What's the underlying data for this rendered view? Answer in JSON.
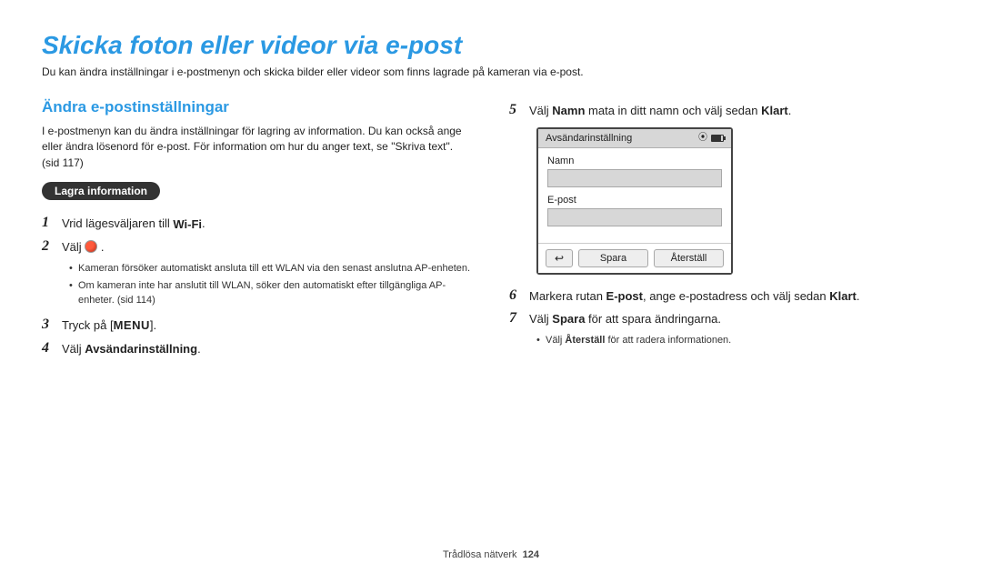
{
  "title": "Skicka foton eller videor via e-post",
  "intro": "Du kan ändra inställningar i e-postmenyn och skicka bilder eller videor som finns lagrade på kameran via e-post.",
  "left": {
    "heading": "Ändra e-postinställningar",
    "para": "I e-postmenyn kan du ändra inställningar för lagring av information. Du kan också ange eller ändra lösenord för e-post. För information om hur du anger text, se \"Skriva text\". (sid 117)",
    "pill": "Lagra information",
    "steps": {
      "s1_pre": "Vrid lägesväljaren till ",
      "wifi_label": "Wi-Fi",
      "s2": "Välj ",
      "bullets": [
        "Kameran försöker automatiskt ansluta till ett WLAN via den senast anslutna AP-enheten.",
        "Om kameran inte har anslutit till WLAN, söker den automatiskt efter tillgängliga AP-enheter. (sid 114)"
      ],
      "s3_pre": "Tryck på [",
      "menu_label": "MENU",
      "s3_post": "].",
      "s4_pre": "Välj ",
      "s4_bold": "Avsändarinställning",
      "s4_post": "."
    }
  },
  "right": {
    "s5_pre": "Välj ",
    "s5_b1": "Namn",
    "s5_mid": " mata in ditt namn och välj sedan ",
    "s5_b2": "Klart",
    "s5_post": ".",
    "panel": {
      "title": "Avsändarinställning",
      "label1": "Namn",
      "label2": "E-post",
      "save": "Spara",
      "reset": "Återställ",
      "back_glyph": "↩"
    },
    "s6_pre": "Markera rutan ",
    "s6_b1": "E-post",
    "s6_mid": ", ange e-postadress och välj sedan ",
    "s6_b2": "Klart",
    "s6_post": ".",
    "s7_pre": "Välj ",
    "s7_b1": "Spara",
    "s7_post": " för att spara ändringarna.",
    "s7_bullet_pre": "Välj ",
    "s7_bullet_b": "Återställ",
    "s7_bullet_post": " för att radera informationen."
  },
  "footer": {
    "section": "Trådlösa nätverk",
    "page": "124"
  }
}
